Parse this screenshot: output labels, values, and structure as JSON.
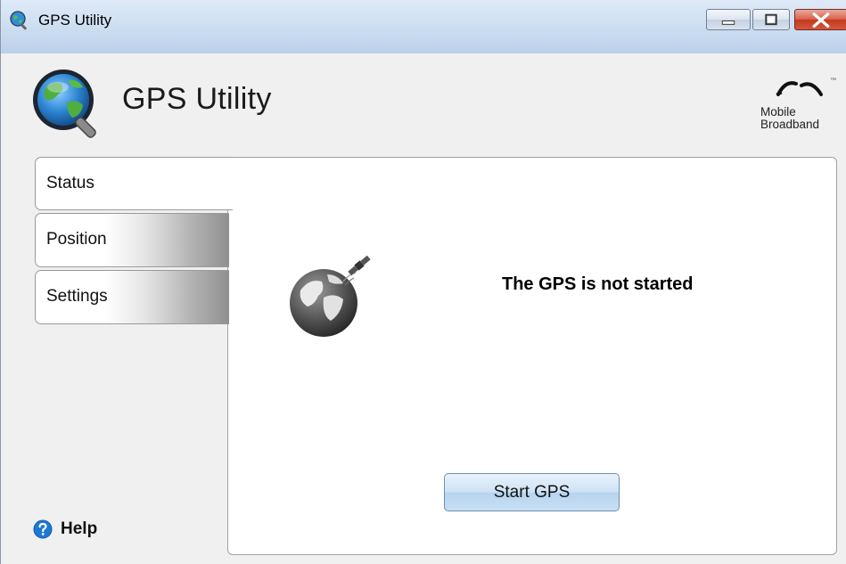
{
  "window": {
    "title": "GPS Utility",
    "controls": {
      "minimize": "minimize",
      "maximize": "maximize",
      "close": "close"
    }
  },
  "header": {
    "app_title": "GPS Utility",
    "brand": {
      "line1": "Mobile",
      "line2": "Broadband"
    }
  },
  "tabs": [
    {
      "label": "Status",
      "active": true
    },
    {
      "label": "Position",
      "active": false
    },
    {
      "label": "Settings",
      "active": false
    }
  ],
  "main": {
    "status_text": "The GPS is not started",
    "start_button_label": "Start GPS"
  },
  "help": {
    "label": "Help"
  },
  "icons": {
    "app": "globe-magnifier-icon",
    "status": "globe-satellite-icon",
    "help": "question-circle-icon",
    "brand": "mobile-broadband-logo"
  },
  "colors": {
    "titlebar": "#cfdff2",
    "close_button": "#c23a1f",
    "help_icon": "#1e78d7",
    "button": "#cfe3f5"
  }
}
